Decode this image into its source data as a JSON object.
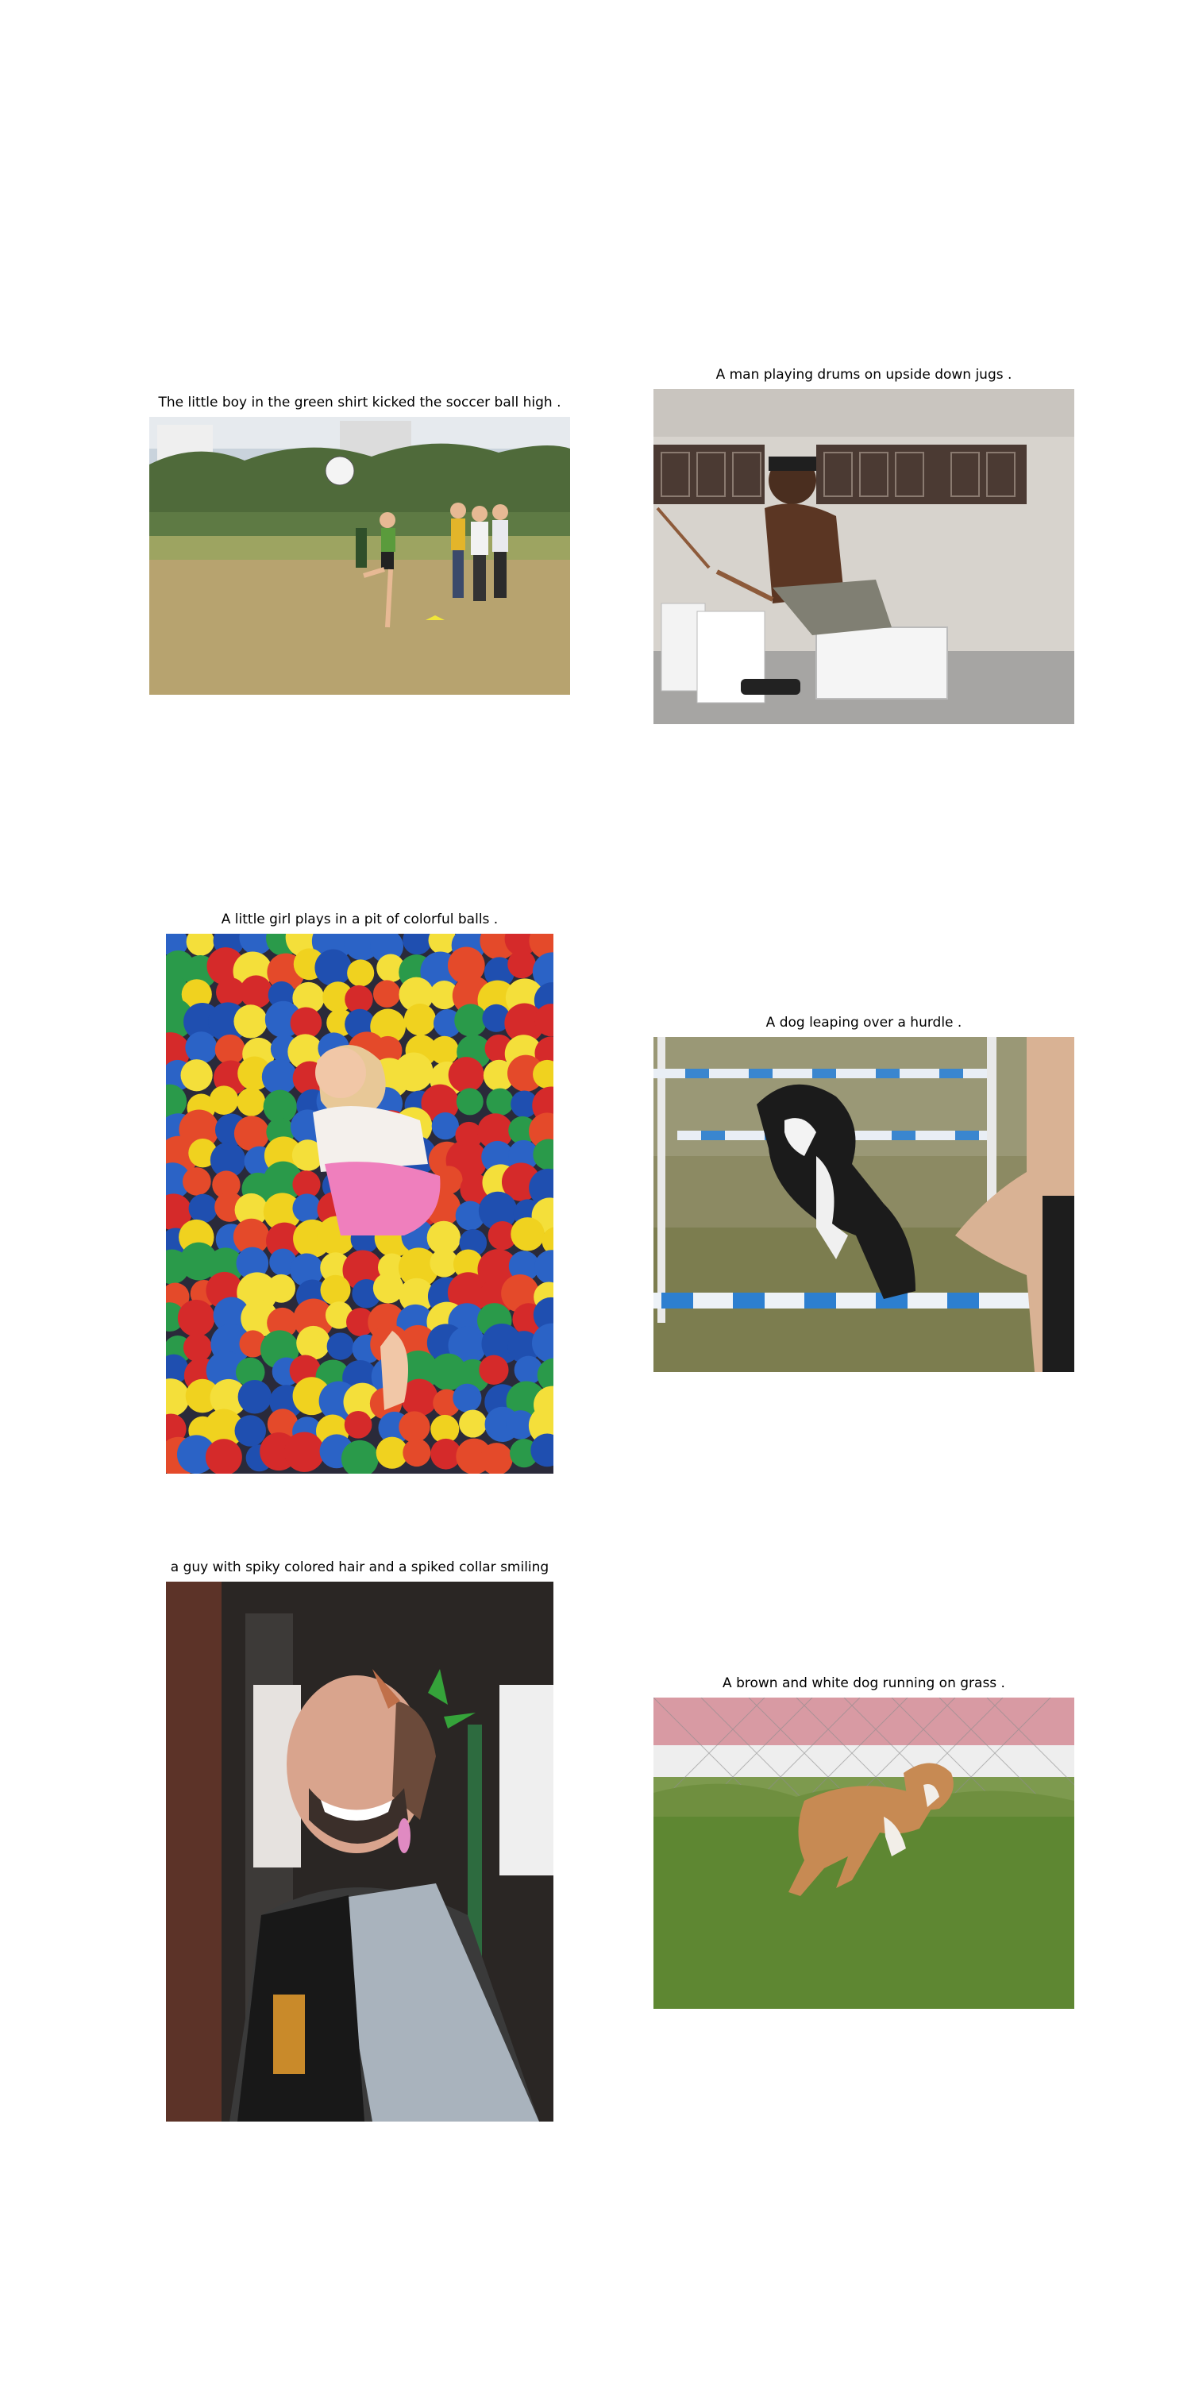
{
  "panels": [
    {
      "caption": "The little boy in the green shirt kicked the soccer ball high .",
      "image_subject": "boy-kicking-soccer-ball-photo"
    },
    {
      "caption": "A man playing drums on upside down jugs .",
      "image_subject": "man-drumming-on-jugs-photo"
    },
    {
      "caption": "A little girl plays in a pit of colorful balls .",
      "image_subject": "girl-in-ball-pit-photo"
    },
    {
      "caption": "A dog leaping over a hurdle .",
      "image_subject": "dog-leaping-hurdle-photo"
    },
    {
      "caption": "a guy with spiky colored hair and a spiked collar smiling",
      "image_subject": "man-with-spiky-hair-photo"
    },
    {
      "caption": "A brown and white dog running on grass .",
      "image_subject": "dog-running-on-grass-photo"
    }
  ]
}
